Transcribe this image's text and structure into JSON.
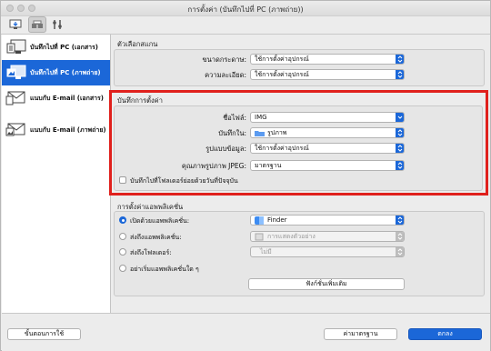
{
  "window": {
    "title": "การตั้งค่า (บันทึกไปที่ PC (ภาพถ่าย))"
  },
  "toolbar": {
    "icons": [
      "scan-to-pc-icon",
      "tab-scanner-icon",
      "tab-tools-icon"
    ]
  },
  "sidebar": {
    "items": [
      {
        "label": "บันทึกไปที่ PC (เอกสาร)",
        "icon": "save-document-icon"
      },
      {
        "label": "บันทึกไปที่ PC (ภาพถ่าย)",
        "icon": "save-photo-icon",
        "selected": true
      },
      {
        "label": "แนบกับ E-mail (เอกสาร)",
        "icon": "email-document-icon"
      },
      {
        "label": "แนบกับ E-mail (ภาพถ่าย)",
        "icon": "email-photo-icon"
      }
    ]
  },
  "scan_options": {
    "title": "ตัวเลือกสแกน",
    "paper_size": {
      "label": "ขนาดกระดาษ:",
      "value": "ใช้การตั้งค่าอุปกรณ์"
    },
    "resolution": {
      "label": "ความละเอียด:",
      "value": "ใช้การตั้งค่าอุปกรณ์"
    }
  },
  "save_settings": {
    "title": "บันทึกการตั้งค่า",
    "file_name": {
      "label": "ชื่อไฟล์:",
      "value": "IMG"
    },
    "save_in": {
      "label": "บันทึกใน:",
      "value": "รูปภาพ"
    },
    "data_format": {
      "label": "รูปแบบข้อมูล:",
      "value": "ใช้การตั้งค่าอุปกรณ์"
    },
    "jpeg_quality": {
      "label": "คุณภาพรูปภาพ JPEG:",
      "value": "มาตรฐาน"
    },
    "subfolder_checkbox": {
      "label": "บันทึกไปที่โฟลเดอร์ย่อยด้วยวันที่ปัจจุบัน",
      "checked": false
    }
  },
  "app_settings": {
    "title": "การตั้งค่าแอพพลิเคชั่น",
    "options": [
      {
        "label": "เปิดด้วยแอพพลิเคชั่น:",
        "value": "Finder",
        "selected": true,
        "enabled": true
      },
      {
        "label": "ส่งถึงแอพพลิเคชั่น:",
        "value": "การแสดงตัวอย่าง",
        "selected": false,
        "enabled": false
      },
      {
        "label": "ส่งถึงโฟลเดอร์:",
        "value": "ไม่มี",
        "selected": false,
        "enabled": false
      },
      {
        "label": "อย่าเริ่มแอพพลิเคชั่นใด ๆ",
        "selected": false
      }
    ],
    "more_functions_button": "ฟังก์ชั่นเพิ่มเติม"
  },
  "footer": {
    "instructions_button": "ขั้นตอนการใช้",
    "defaults_button": "ค่ามาตรฐาน",
    "ok_button": "ตกลง"
  },
  "colors": {
    "accent": "#1b67d8",
    "highlight_border": "#e0201c"
  }
}
